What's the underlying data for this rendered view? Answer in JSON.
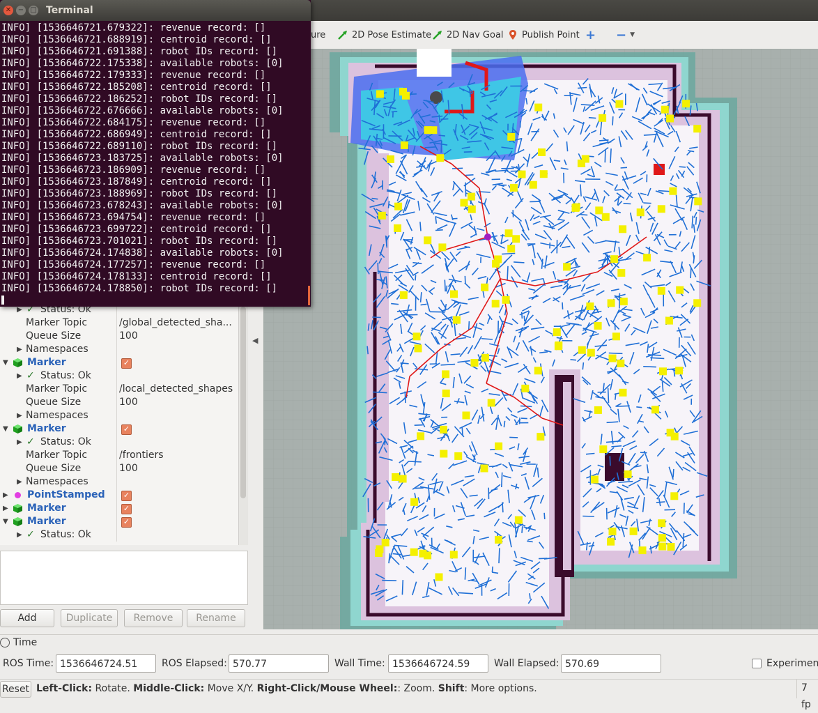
{
  "terminal": {
    "title": "Terminal",
    "lines": [
      "INFO] [1536646721.679322]: revenue record: []",
      "INFO] [1536646721.688919]: centroid record: []",
      "INFO] [1536646721.691388]: robot IDs record: []",
      "INFO] [1536646722.175338]: available robots: [0]",
      "INFO] [1536646722.179333]: revenue record: []",
      "INFO] [1536646722.185208]: centroid record: []",
      "INFO] [1536646722.186252]: robot IDs record: []",
      "INFO] [1536646722.676666]: available robots: [0]",
      "INFO] [1536646722.684175]: revenue record: []",
      "INFO] [1536646722.686949]: centroid record: []",
      "INFO] [1536646722.689110]: robot IDs record: []",
      "INFO] [1536646723.183725]: available robots: [0]",
      "INFO] [1536646723.186909]: revenue record: []",
      "INFO] [1536646723.187849]: centroid record: []",
      "INFO] [1536646723.188969]: robot IDs record: []",
      "INFO] [1536646723.678243]: available robots: [0]",
      "INFO] [1536646723.694754]: revenue record: []",
      "INFO] [1536646723.699722]: centroid record: []",
      "INFO] [1536646723.701021]: robot IDs record: []",
      "INFO] [1536646724.174838]: available robots: [0]",
      "INFO] [1536646724.177257]: revenue record: []",
      "INFO] [1536646724.178133]: centroid record: []",
      "INFO] [1536646724.178850]: robot IDs record: []"
    ]
  },
  "toolbar": {
    "measure_partial": "ure",
    "pose_estimate": "2D Pose Estimate",
    "nav_goal": "2D Nav Goal",
    "publish_point": "Publish Point",
    "plus": "+",
    "minus": "−"
  },
  "displays": {
    "r1_status": "Status: Ok",
    "r2_key": "Marker Topic",
    "r2_val": "/global_detected_sha...",
    "r3_key": "Queue Size",
    "r3_val": "100",
    "r4_key": "Namespaces",
    "r5_name": "Marker",
    "r6_status": "Status: Ok",
    "r7_key": "Marker Topic",
    "r7_val": "/local_detected_shapes",
    "r8_key": "Queue Size",
    "r8_val": "100",
    "r9_key": "Namespaces",
    "r10_name": "Marker",
    "r11_status": "Status: Ok",
    "r12_key": "Marker Topic",
    "r12_val": "/frontiers",
    "r13_key": "Queue Size",
    "r13_val": "100",
    "r14_key": "Namespaces",
    "r15_name": "PointStamped",
    "r16_name": "Marker",
    "r17_name": "Marker",
    "r18_status": "Status: Ok"
  },
  "buttons": {
    "add": "Add",
    "duplicate": "Duplicate",
    "remove": "Remove",
    "rename": "Rename"
  },
  "time": {
    "header": "Time",
    "ros_time_label": "ROS Time:",
    "ros_time": "1536646724.51",
    "ros_elapsed_label": "ROS Elapsed:",
    "ros_elapsed": "570.77",
    "wall_time_label": "Wall Time:",
    "wall_time": "1536646724.59",
    "wall_elapsed_label": "Wall Elapsed:",
    "wall_elapsed": "570.69",
    "experimental": "Experimen"
  },
  "status": {
    "reset": "Reset",
    "left_click": "Left-Click:",
    "left_click_desc": " Rotate. ",
    "middle_click": "Middle-Click:",
    "middle_click_desc": " Move X/Y. ",
    "right_click": "Right-Click/Mouse Wheel:",
    "right_click_desc": ": Zoom. ",
    "shift": "Shift",
    "shift_desc": ": More options.",
    "fps": "7 fp"
  },
  "colors": {
    "terminal_bg": "#300a24",
    "map_blue": "#1f6fd6",
    "map_red": "#e01818",
    "frontier_yellow": "#f4f000",
    "link_blue": "#2a62b8"
  }
}
